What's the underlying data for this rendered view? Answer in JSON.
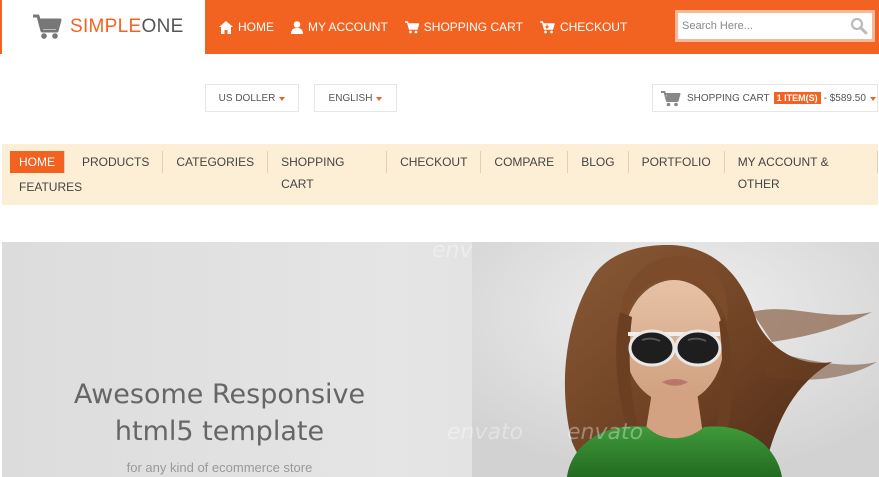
{
  "logo": {
    "part1": "SIMPLE",
    "part2": "ONE"
  },
  "top_nav": [
    {
      "label": "HOME",
      "icon": "home-icon"
    },
    {
      "label": "MY ACCOUNT",
      "icon": "user-icon"
    },
    {
      "label": "SHOPPING CART",
      "icon": "cart-icon"
    },
    {
      "label": "CHECKOUT",
      "icon": "checkout-cart-icon"
    }
  ],
  "search": {
    "placeholder": "Search Here..."
  },
  "selectors": {
    "currency": "US DOLLER",
    "language": "ENGLISH",
    "cart_label": "SHOPPING CART",
    "cart_items": "1 ITEM(S)",
    "cart_total": "- $589.50"
  },
  "main_menu": {
    "row1": [
      "HOME",
      "PRODUCTS",
      "CATEGORIES",
      "SHOPPING CART",
      "CHECKOUT",
      "COMPARE",
      "BLOG",
      "PORTFOLIO",
      "MY ACCOUNT & OTHER"
    ],
    "row2": [
      "FEATURES"
    ]
  },
  "banner": {
    "title_line1": "Awesome Responsive",
    "title_line2": "html5 template",
    "subtitle": "for any kind of ecommerce store",
    "watermark": "envato"
  },
  "colors": {
    "accent": "#f26322",
    "menu_bg": "#fdefd6",
    "banner_bg": "#e0e0e0"
  }
}
